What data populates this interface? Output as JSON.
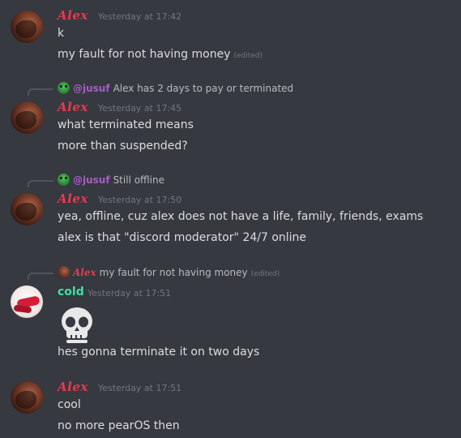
{
  "messages": [
    {
      "author": "Alex",
      "timestamp": "Yesterday at 17:42",
      "lines": [
        "k",
        "my fault for not having money"
      ],
      "edited_label": "(edited)"
    },
    {
      "reply": {
        "mention": "@jusuf",
        "text": "Alex has 2 days to pay or terminated"
      },
      "author": "Alex",
      "timestamp": "Yesterday at 17:45",
      "lines": [
        "what terminated means",
        "more than suspended?"
      ]
    },
    {
      "reply": {
        "mention": "@jusuf",
        "text": "Still offline"
      },
      "author": "Alex",
      "timestamp": "Yesterday at 17:50",
      "lines": [
        "yea, offline, cuz alex does not have a life, family, friends, exams",
        "alex is that \"discord moderator\" 24/7 online"
      ]
    },
    {
      "reply": {
        "author": "Alex",
        "text": "my fault for not having money",
        "edited_label": "(edited)"
      },
      "author": "cold",
      "timestamp": "Yesterday at 17:51",
      "emoji": "skull",
      "lines": [
        "hes gonna terminate it on two days"
      ]
    },
    {
      "author": "Alex",
      "timestamp": "Yesterday at 17:51",
      "lines": [
        "cool",
        "no more pearOS then"
      ]
    }
  ],
  "colors": {
    "background": "#36393f",
    "alex_name": "#e83a4f",
    "cold_name": "#3ce1a3",
    "jusuf_mention": "#a95bc9",
    "timestamp": "#72767d"
  }
}
